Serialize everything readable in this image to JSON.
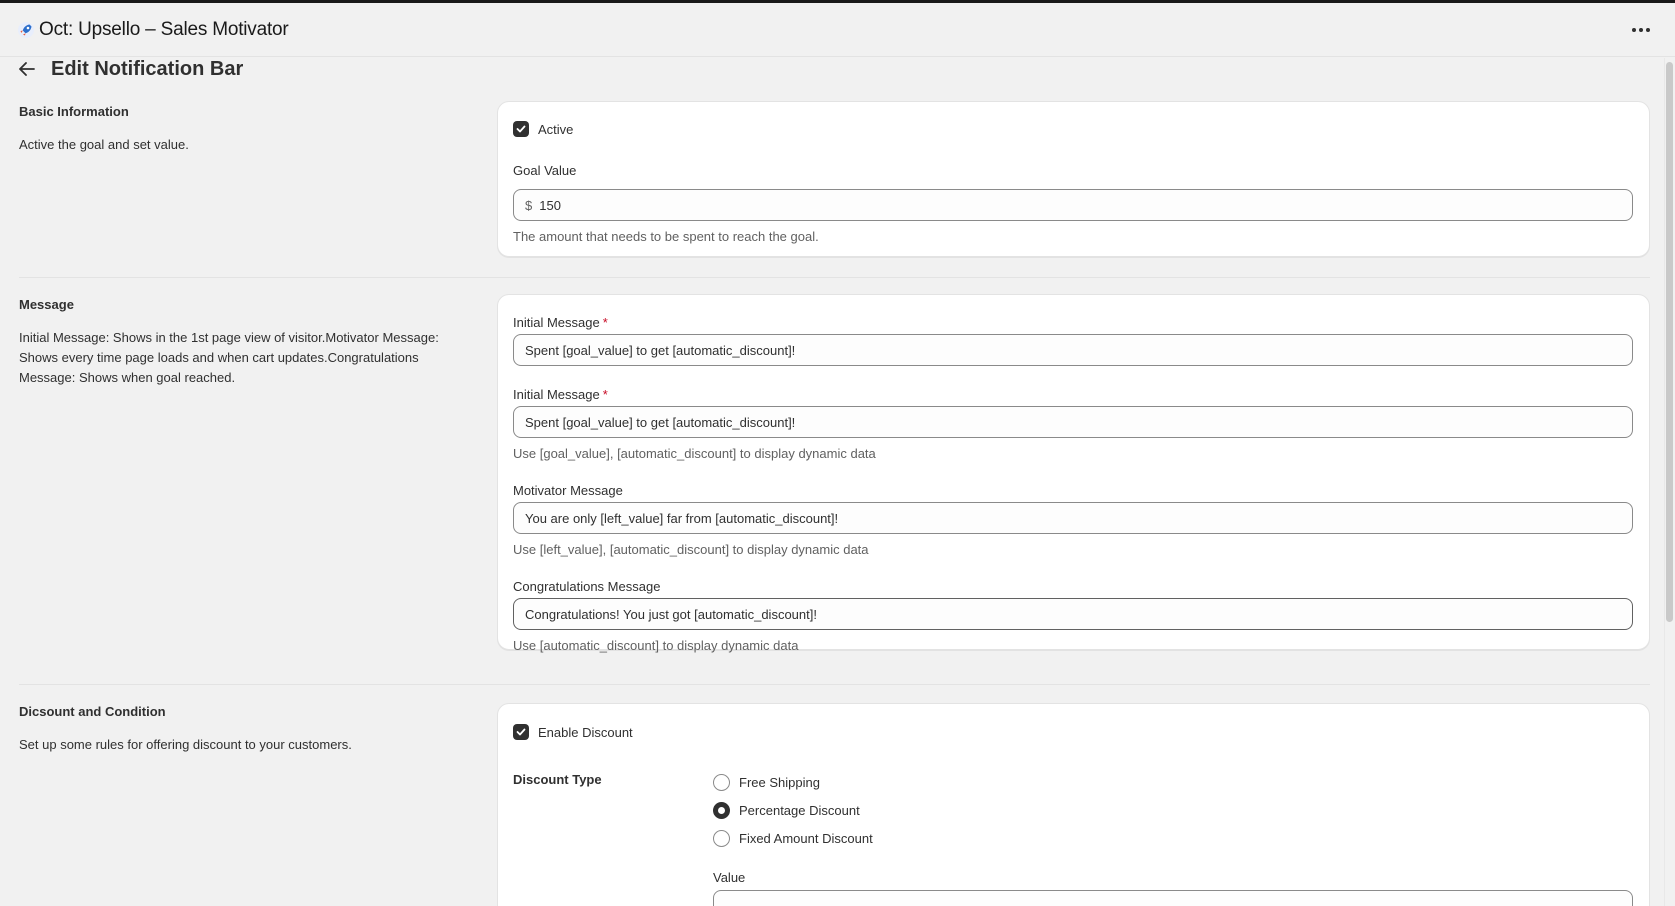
{
  "app": {
    "title": "Oct: Upsello – Sales Motivator",
    "icon": "rocket-icon",
    "menu_icon": "more-horizontal-icon"
  },
  "page": {
    "title": "Edit Notification Bar",
    "back_icon": "arrow-left-icon"
  },
  "basic_info": {
    "title": "Basic Information",
    "description": "Active the goal and set value.",
    "active_label": "Active",
    "active_checked": true,
    "goal_value_label": "Goal Value",
    "goal_value_prefix": "$",
    "goal_value": "150",
    "goal_value_help": "The amount that needs to be spent to reach the goal."
  },
  "message": {
    "title": "Message",
    "description": "Initial Message: Shows in the 1st page view of visitor.Motivator Message: Shows every time page loads and when cart updates.Congratulations Message: Shows when goal reached.",
    "initial_label_1": "Initial Message",
    "initial_value_1": "Spent [goal_value] to get [automatic_discount]!",
    "initial_label_2": "Initial Message",
    "initial_value_2": "Spent [goal_value] to get [automatic_discount]!",
    "initial_help": "Use [goal_value], [automatic_discount] to display dynamic data",
    "required_mark": "*",
    "motivator_label": "Motivator Message",
    "motivator_value": "You are only [left_value] far from [automatic_discount]!",
    "motivator_help": "Use [left_value], [automatic_discount] to display dynamic data",
    "congrats_label": "Congratulations Message",
    "congrats_value": "Congratulations! You just got [automatic_discount]!",
    "congrats_help": "Use [automatic_discount] to display dynamic data"
  },
  "discount": {
    "title": "Dicsount and Condition",
    "description": "Set up some rules for offering discount to your customers.",
    "enable_label": "Enable Discount",
    "enable_checked": true,
    "type_label": "Discount Type",
    "options": [
      "Free Shipping",
      "Percentage Discount",
      "Fixed Amount Discount"
    ],
    "selected_option": "Percentage Discount",
    "value_label": "Value"
  },
  "colors": {
    "background": "#f1f1f1",
    "card": "#ffffff",
    "text": "#303030",
    "subdued": "#616161",
    "required": "#c70a24"
  }
}
